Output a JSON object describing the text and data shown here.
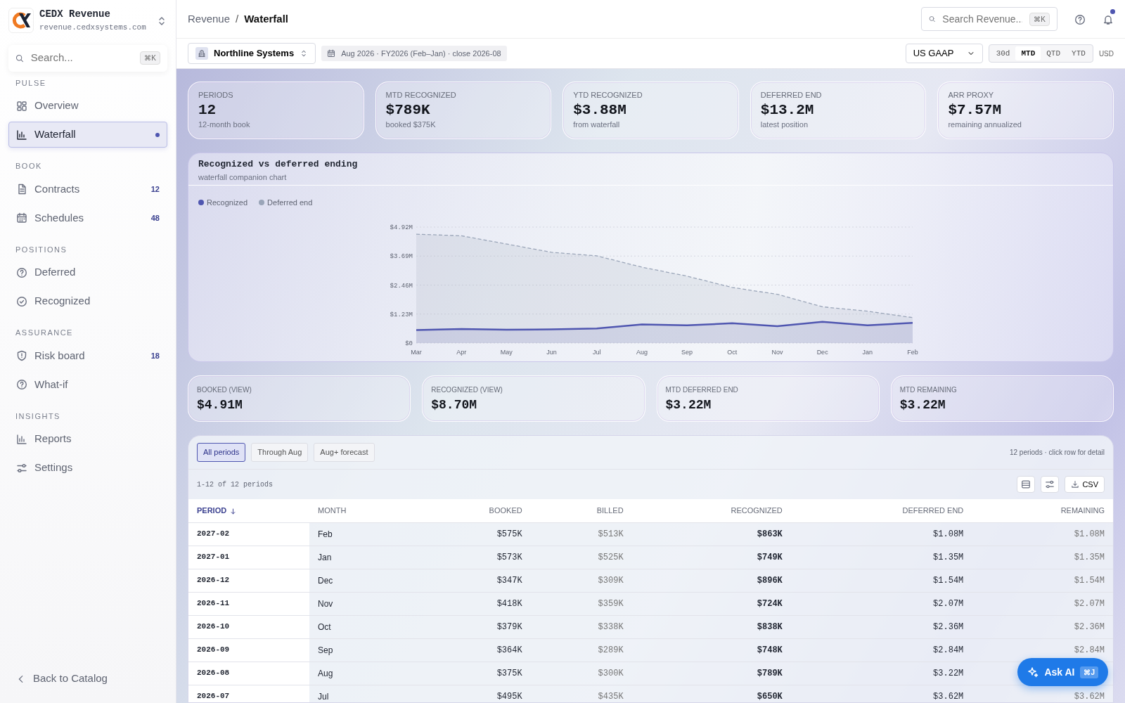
{
  "brand": {
    "name": "CEDX Revenue",
    "domain": "revenue.cedxsystems.com"
  },
  "sidebar": {
    "search": {
      "placeholder": "Search...",
      "shortcut": "⌘K"
    },
    "sections": [
      {
        "title": "PULSE",
        "items": [
          {
            "label": "Overview",
            "selected": false
          },
          {
            "label": "Waterfall",
            "selected": true
          }
        ]
      },
      {
        "title": "BOOK",
        "items": [
          {
            "label": "Contracts",
            "selected": false,
            "count": "12"
          },
          {
            "label": "Schedules",
            "selected": false,
            "count": "48"
          }
        ]
      },
      {
        "title": "POSITIONS",
        "items": [
          {
            "label": "Deferred",
            "selected": false
          },
          {
            "label": "Recognized",
            "selected": false
          }
        ]
      },
      {
        "title": "ASSURANCE",
        "items": [
          {
            "label": "Risk board",
            "selected": false,
            "count": "18"
          },
          {
            "label": "What-if",
            "selected": false
          }
        ]
      },
      {
        "title": "INSIGHTS",
        "items": [
          {
            "label": "Reports",
            "selected": false
          },
          {
            "label": "Settings",
            "selected": false
          }
        ]
      }
    ],
    "back": "Back to Catalog"
  },
  "breadcrumb": [
    "Revenue",
    "Waterfall"
  ],
  "breadcrumb_separator": "/",
  "top_search": {
    "placeholder": "Search Revenue...",
    "shortcut": "⌘K"
  },
  "notifications": {
    "unread": true
  },
  "entity": "Northline Systems",
  "period_info": "Aug 2026 · FY2026 (Feb–Jan) · close 2026-08",
  "standard": "US GAAP",
  "ranges": [
    {
      "label": "30d",
      "selected": false
    },
    {
      "label": "MTD",
      "selected": true
    },
    {
      "label": "QTD",
      "selected": false
    },
    {
      "label": "YTD",
      "selected": false
    }
  ],
  "currency": "USD",
  "kpis": [
    {
      "label": "PERIODS",
      "value": "12",
      "sub": "12-month book"
    },
    {
      "label": "MTD RECOGNIZED",
      "value": "$789K",
      "sub": "booked $375K"
    },
    {
      "label": "YTD RECOGNIZED",
      "value": "$3.88M",
      "sub": "from waterfall"
    },
    {
      "label": "DEFERRED END",
      "value": "$13.2M",
      "sub": "latest position"
    },
    {
      "label": "ARR PROXY",
      "value": "$7.57M",
      "sub": "remaining annualized"
    }
  ],
  "chart": {
    "title": "Recognized vs deferred ending",
    "subtitle": "waterfall companion chart",
    "chart_data": {
      "type": "area",
      "categories": [
        "Mar",
        "Apr",
        "May",
        "Jun",
        "Jul",
        "Aug",
        "Sep",
        "Oct",
        "Nov",
        "Dec",
        "Jan",
        "Feb"
      ],
      "ylim": [
        0,
        4.92
      ],
      "grid": true,
      "yticks": [
        {
          "value": 0,
          "label": "$0"
        },
        {
          "value": 1.23,
          "label": "$1.23M"
        },
        {
          "value": 2.46,
          "label": "$2.46M"
        },
        {
          "value": 3.69,
          "label": "$3.69M"
        },
        {
          "value": 4.92,
          "label": "$4.92M"
        }
      ],
      "series": [
        {
          "name": "Recognized",
          "color": "#4f56b0",
          "values": [
            0.55,
            0.6,
            0.57,
            0.58,
            0.62,
            0.79,
            0.75,
            0.84,
            0.72,
            0.9,
            0.75,
            0.86
          ]
        },
        {
          "name": "Deferred end",
          "color": "#9aa5b8",
          "values": [
            4.62,
            4.55,
            4.2,
            3.85,
            3.7,
            3.22,
            2.84,
            2.36,
            2.07,
            1.54,
            1.35,
            1.08
          ]
        }
      ]
    }
  },
  "summary": [
    {
      "label": "BOOKED (VIEW)",
      "value": "$4.91M"
    },
    {
      "label": "RECOGNIZED (VIEW)",
      "value": "$8.70M"
    },
    {
      "label": "MTD DEFERRED END",
      "value": "$3.22M"
    },
    {
      "label": "MTD REMAINING",
      "value": "$3.22M"
    }
  ],
  "filters": [
    {
      "label": "All periods",
      "selected": true
    },
    {
      "label": "Through Aug",
      "selected": false
    },
    {
      "label": "Aug+ forecast",
      "selected": false
    }
  ],
  "table_hint": "12 periods · click row for detail",
  "table_count": "1-12 of 12 periods",
  "csv": "CSV",
  "table": {
    "columns": [
      {
        "label": "PERIOD",
        "sorted": true
      },
      {
        "label": "MONTH",
        "sorted": false
      },
      {
        "label": "BOOKED",
        "sorted": false
      },
      {
        "label": "BILLED",
        "sorted": false
      },
      {
        "label": "RECOGNIZED",
        "sorted": false
      },
      {
        "label": "DEFERRED END",
        "sorted": false
      },
      {
        "label": "REMAINING",
        "sorted": false
      }
    ],
    "rows": [
      [
        "2027-02",
        "Feb",
        "$575K",
        "$513K",
        "$863K",
        "$1.08M",
        "$1.08M"
      ],
      [
        "2027-01",
        "Jan",
        "$573K",
        "$525K",
        "$749K",
        "$1.35M",
        "$1.35M"
      ],
      [
        "2026-12",
        "Dec",
        "$347K",
        "$309K",
        "$896K",
        "$1.54M",
        "$1.54M"
      ],
      [
        "2026-11",
        "Nov",
        "$418K",
        "$359K",
        "$724K",
        "$2.07M",
        "$2.07M"
      ],
      [
        "2026-10",
        "Oct",
        "$379K",
        "$338K",
        "$838K",
        "$2.36M",
        "$2.36M"
      ],
      [
        "2026-09",
        "Sep",
        "$364K",
        "$289K",
        "$748K",
        "$2.84M",
        "$2.84M"
      ],
      [
        "2026-08",
        "Aug",
        "$375K",
        "$300K",
        "$789K",
        "$3.22M",
        null
      ],
      [
        "2026-07",
        "Jul",
        "$495K",
        "$435K",
        "$650K",
        "$3.62M",
        "$3.62M"
      ]
    ]
  },
  "ask_ai": {
    "label": "Ask AI",
    "shortcut": "⌘J"
  }
}
